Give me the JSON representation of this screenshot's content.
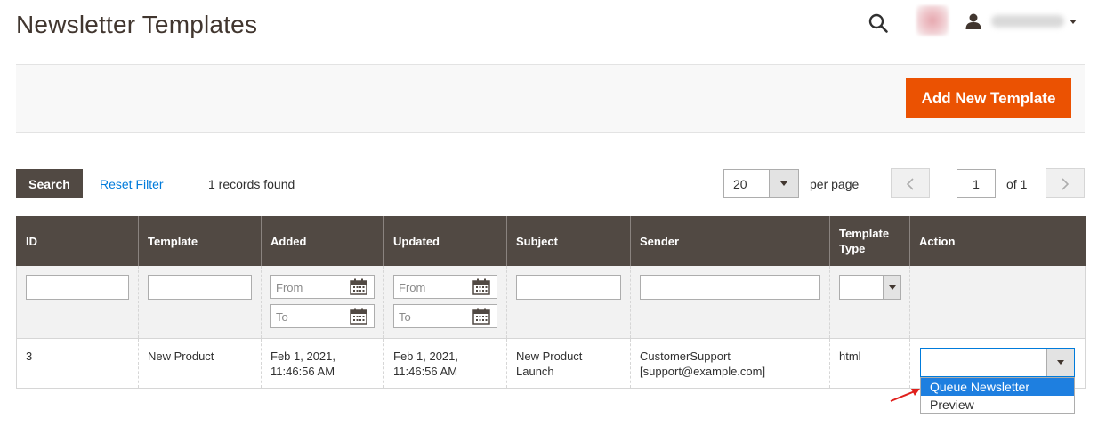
{
  "header": {
    "title": "Newsletter Templates",
    "icons": {
      "search": "search-icon",
      "user": "user-icon",
      "caret": "chevron-down-icon"
    }
  },
  "actions": {
    "add_new_label": "Add New Template",
    "accent_color": "#eb5202"
  },
  "toolbar": {
    "search_label": "Search",
    "reset_label": "Reset Filter",
    "records_text": "1 records found",
    "per_page_value": "20",
    "per_page_label": "per page",
    "current_page": "1",
    "page_of": "of 1"
  },
  "grid": {
    "headers": {
      "id": "ID",
      "template": "Template",
      "added": "Added",
      "updated": "Updated",
      "subject": "Subject",
      "sender": "Sender",
      "template_type": "Template Type",
      "action": "Action"
    },
    "filters": {
      "date_from_placeholder": "From",
      "date_to_placeholder": "To"
    },
    "rows": [
      {
        "id": "3",
        "template": "New Product",
        "added_date": "Feb 1, 2021,",
        "added_time": "11:46:56 AM",
        "updated_date": "Feb 1, 2021,",
        "updated_time": "11:46:56 AM",
        "subject_line1": "New Product",
        "subject_line2": "Launch",
        "sender_name": "CustomerSupport",
        "sender_email": "[support@example.com]",
        "template_type": "html"
      }
    ],
    "header_color": "#514943"
  },
  "action_dropdown": {
    "options": [
      "Queue Newsletter",
      "Preview"
    ],
    "highlighted_index": 0,
    "highlight_color": "#1e7fe0"
  }
}
